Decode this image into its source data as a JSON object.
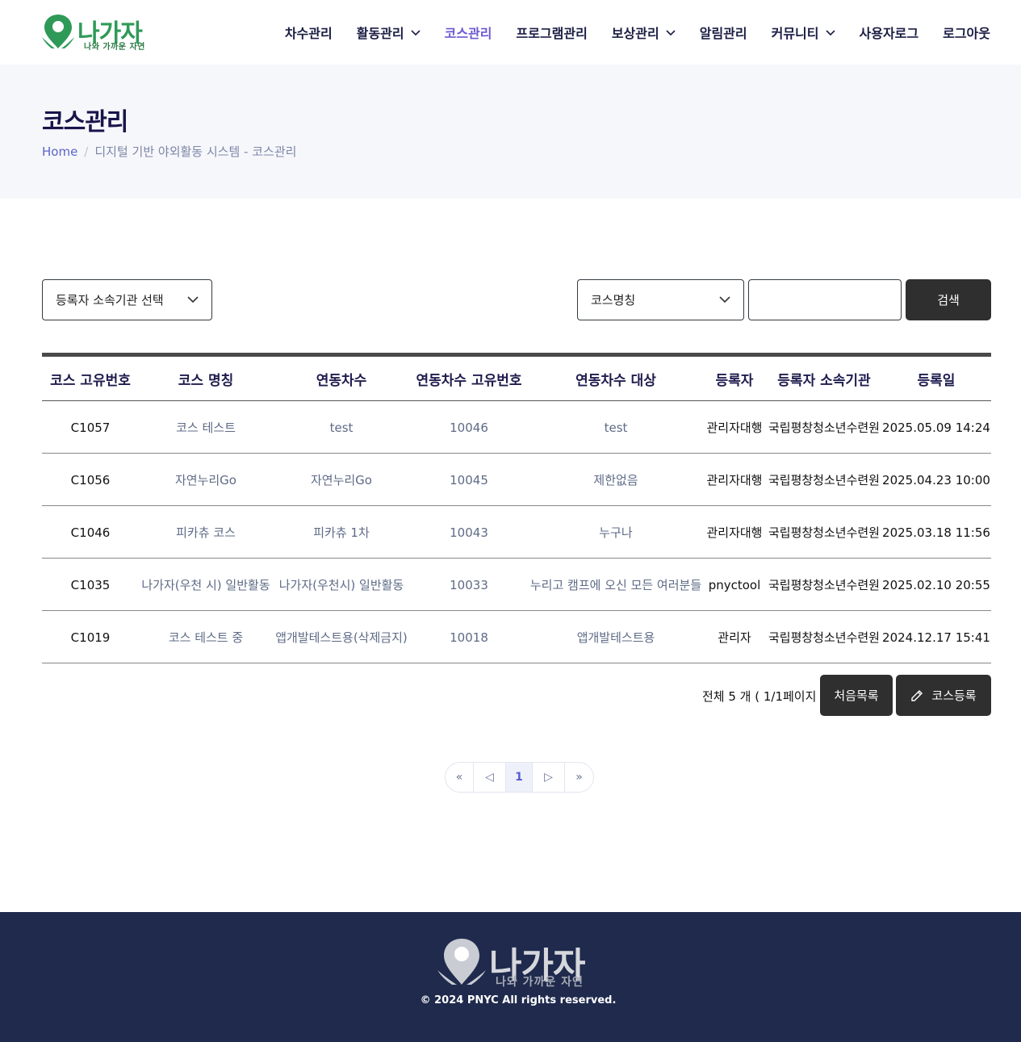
{
  "header": {
    "logo_text": "나가자",
    "logo_tagline": "나와 가까운 자연",
    "nav": [
      {
        "label": "차수관리",
        "has_dropdown": false,
        "active": false
      },
      {
        "label": "활동관리",
        "has_dropdown": true,
        "active": false
      },
      {
        "label": "코스관리",
        "has_dropdown": false,
        "active": true
      },
      {
        "label": "프로그램관리",
        "has_dropdown": false,
        "active": false
      },
      {
        "label": "보상관리",
        "has_dropdown": true,
        "active": false
      },
      {
        "label": "알림관리",
        "has_dropdown": false,
        "active": false
      },
      {
        "label": "커뮤니티",
        "has_dropdown": true,
        "active": false
      },
      {
        "label": "사용자로그",
        "has_dropdown": false,
        "active": false
      },
      {
        "label": "로그아웃",
        "has_dropdown": false,
        "active": false
      }
    ]
  },
  "page": {
    "title": "코스관리",
    "breadcrumb_home": "Home",
    "breadcrumb_separator": "/",
    "breadcrumb_current": "디지털 기반 야외활동 시스템 - 코스관리"
  },
  "filters": {
    "org_select": "등록자 소속기관 선택",
    "type_select": "코스명칭",
    "search_value": "",
    "search_button": "검색"
  },
  "table": {
    "columns": [
      "코스 고유번호",
      "코스 명칭",
      "연동차수",
      "연동차수 고유번호",
      "연동차수 대상",
      "등록자",
      "등록자 소속기관",
      "등록일"
    ],
    "rows": [
      [
        "C1057",
        "코스 테스트",
        "test",
        "10046",
        "test",
        "관리자대행",
        "국립평창청소년수련원",
        "2025.05.09 14:24"
      ],
      [
        "C1056",
        "자연누리Go",
        "자연누리Go",
        "10045",
        "제한없음",
        "관리자대행",
        "국립평창청소년수련원",
        "2025.04.23 10:00"
      ],
      [
        "C1046",
        "피카츄 코스",
        "피카츄 1차",
        "10043",
        "누구나",
        "관리자대행",
        "국립평창청소년수련원",
        "2025.03.18 11:56"
      ],
      [
        "C1035",
        "나가자(우천 시) 일반활동",
        "나가자(우천시) 일반활동",
        "10033",
        "누리고 캠프에 오신 모든 여러분들",
        "pnyctool",
        "국립평창청소년수련원",
        "2025.02.10 20:55"
      ],
      [
        "C1019",
        "코스 테스트 중",
        "앱개발테스트용(삭제금지)",
        "10018",
        "앱개발테스트용",
        "관리자",
        "국립평창청소년수련원",
        "2024.12.17 15:41"
      ]
    ]
  },
  "summary": {
    "total_text": "전체 5 개 ( 1/1페이지 )",
    "first_list_button": "처음목록",
    "register_button": "코스등록"
  },
  "pagination": {
    "first": "«",
    "prev": "◁",
    "current": "1",
    "next": "▷",
    "last": "»"
  },
  "footer": {
    "logo_text": "나가자",
    "logo_tagline": "나와 가까운 자연",
    "copyright": "© 2024 PNYC All rights reserved."
  },
  "colors": {
    "accent": "#6b59d3",
    "logo_green": "#2f9a57",
    "footer_bg": "#1f2a4d",
    "button_dark": "#2f2f2f"
  }
}
